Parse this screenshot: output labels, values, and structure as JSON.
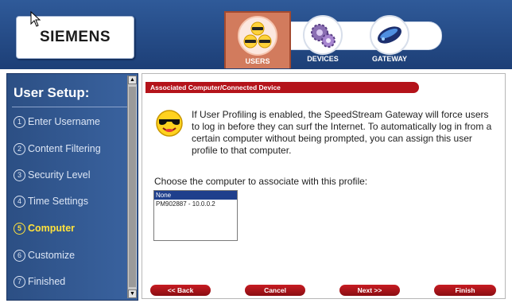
{
  "header": {
    "logo": "SIEMENS",
    "tabs": [
      {
        "label": "USERS",
        "icon": "users-icon",
        "active": true
      },
      {
        "label": "DEVICES",
        "icon": "devices-icon",
        "active": false
      },
      {
        "label": "GATEWAY",
        "icon": "gateway-icon",
        "active": false
      }
    ]
  },
  "sidebar": {
    "title": "User Setup:",
    "steps": [
      {
        "num": "1",
        "label": "Enter Username"
      },
      {
        "num": "2",
        "label": "Content Filtering"
      },
      {
        "num": "3",
        "label": "Security Level"
      },
      {
        "num": "4",
        "label": "Time Settings"
      },
      {
        "num": "5",
        "label": "Computer",
        "active": true
      },
      {
        "num": "6",
        "label": "Customize"
      },
      {
        "num": "7",
        "label": "Finished"
      }
    ]
  },
  "main": {
    "section_title": "Associated Computer/Connected Device",
    "description": "If User Profiling is enabled, the SpeedStream Gateway will force users to log in before they can surf the Internet. To automatically log in from a certain computer without being prompted, you can assign this user profile to that computer.",
    "choose_label": "Choose the computer to associate with this profile:",
    "computer_options": [
      "None",
      "PM902887 - 10.0.0.2"
    ],
    "selected_option": "None"
  },
  "buttons": {
    "back": "<< Back",
    "cancel": "Cancel",
    "next": "Next >>",
    "finish": "Finish"
  },
  "colors": {
    "header_blue": "#1d3f77",
    "accent_red": "#b4131a",
    "active_step": "#ffe23c",
    "active_tab": "#d27b5d"
  }
}
